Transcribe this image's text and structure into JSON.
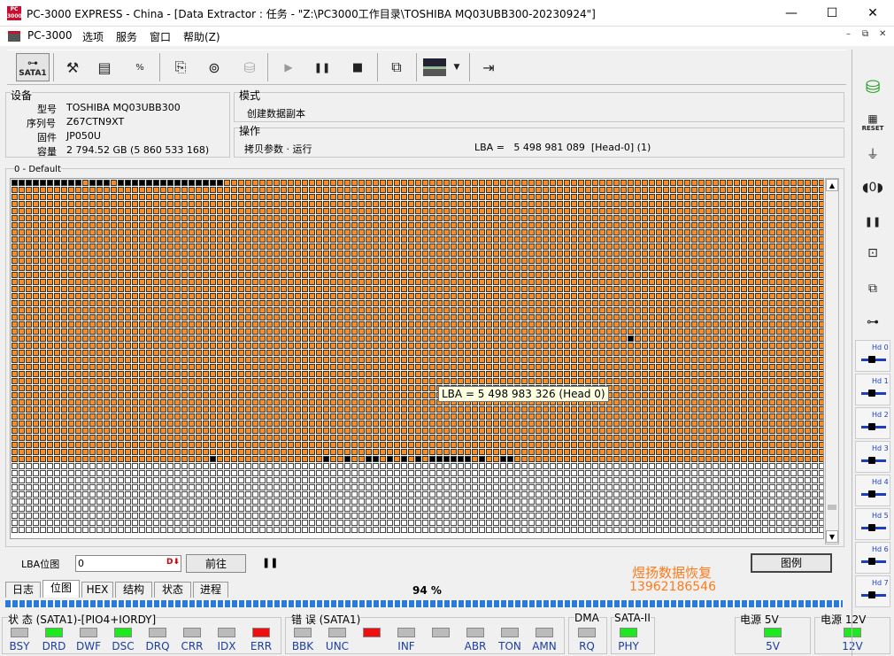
{
  "window": {
    "title": "PC-3000 EXPRESS - China - [Data Extractor : 任务 - \"Z:\\PC3000工作目录\\TOSHIBA MQ03UBB300-20230924\"]",
    "logo_text": "PC\n3000",
    "minimize": "—",
    "maximize": "☐",
    "close": "✕"
  },
  "menubar": {
    "app_menu": "PC-3000",
    "items": [
      "选项",
      "服务",
      "窗口",
      "帮助(Z)"
    ],
    "mdi_controls": [
      "–",
      "⧉",
      "✕"
    ]
  },
  "toolbar": {
    "sata_label": "SATA1",
    "icons": [
      "sata-icon",
      "tools-icon",
      "bios-icon",
      "percent-icon",
      "device-info-icon",
      "binoculars-icon",
      "disk-icon",
      "play-icon",
      "pause-icon",
      "stop-icon",
      "copy-icon",
      "screen-icon",
      "dropdown-icon",
      "exit-icon"
    ],
    "play": "▶",
    "pause": "❚❚",
    "stop": "■",
    "dropdown": "▼"
  },
  "device": {
    "group_title": "设备",
    "model_label": "型号",
    "model_value": "TOSHIBA MQ03UBB300",
    "serial_label": "序列号",
    "serial_value": "Z67CTN9XT",
    "firmware_label": "固件",
    "firmware_value": "JP050U",
    "capacity_label": "容量",
    "capacity_value": "2 794.52 GB (5 860 533 168)"
  },
  "mode": {
    "group_title": "模式",
    "value": "创建数据副本"
  },
  "operation": {
    "group_title": "操作",
    "value": "拷贝参数 · 运行",
    "lba_text": "LBA =   5 498 981 089  [Head-0] (1)"
  },
  "map": {
    "title": "0 - Default",
    "tooltip": "LBA = 5 498 983 326 (Head 0)",
    "scroll_up": "▲",
    "scroll_down": "▼"
  },
  "map_controls": {
    "lba_label": "LBA位图",
    "lba_value": "0",
    "forward_button": "前往",
    "pause_icon": "❚❚",
    "legend_button": "图例",
    "watermark_name": "煜扬数据恢复",
    "watermark_phone": "13962186546"
  },
  "tabs": [
    "日志",
    "位图",
    "HEX",
    "结构",
    "状态",
    "进程"
  ],
  "active_tab": "位图",
  "progress_text": "94 %",
  "progress": 0.94,
  "status_panel": {
    "title": "状 态 (SATA1)-[PIO4+IORDY]",
    "leds": [
      {
        "label": "BSY",
        "state": "off"
      },
      {
        "label": "DRD",
        "state": "green"
      },
      {
        "label": "DWF",
        "state": "off"
      },
      {
        "label": "DSC",
        "state": "green"
      },
      {
        "label": "DRQ",
        "state": "off"
      },
      {
        "label": "CRR",
        "state": "off"
      },
      {
        "label": "IDX",
        "state": "off"
      },
      {
        "label": "ERR",
        "state": "red"
      }
    ]
  },
  "error_panel": {
    "title": "错 误 (SATA1)",
    "leds": [
      {
        "label": "BBK",
        "state": "off"
      },
      {
        "label": "UNC",
        "state": "off"
      },
      {
        "label": "",
        "state": "red"
      },
      {
        "label": "INF",
        "state": "off"
      },
      {
        "label": "",
        "state": "off"
      },
      {
        "label": "ABR",
        "state": "off"
      },
      {
        "label": "TON",
        "state": "off"
      },
      {
        "label": "AMN",
        "state": "off"
      }
    ]
  },
  "dma_panel": {
    "title": "DMA",
    "led": {
      "label": "RQ",
      "state": "off"
    }
  },
  "sata_panel": {
    "title": "SATA-II",
    "led": {
      "label": "PHY",
      "state": "green"
    }
  },
  "power5_panel": {
    "title": "电源 5V",
    "led": {
      "label": "5V",
      "state": "green"
    }
  },
  "power12_panel": {
    "title": "电源 12V",
    "led": {
      "label": "12V",
      "state": "green"
    }
  },
  "right_toolbar": {
    "reset_label": "RESET",
    "heads": [
      "Hd 0",
      "Hd 1",
      "Hd 2",
      "Hd 3",
      "Hd 4",
      "Hd 5",
      "Hd 6",
      "Hd 7"
    ]
  },
  "colors": {
    "read_ok": "#ff8c1a",
    "unread": "#ffffff",
    "bad": "#000000",
    "led_green": "#1ee81e",
    "led_red": "#ee1010",
    "watermark": "#ff7a1a"
  }
}
